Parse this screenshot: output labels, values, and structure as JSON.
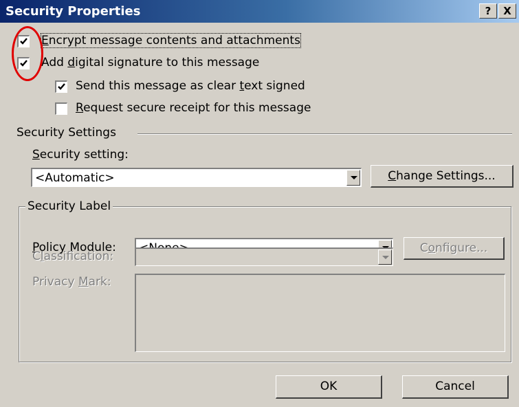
{
  "window": {
    "title": "Security Properties",
    "help_button": "?",
    "close_button": "X"
  },
  "options": {
    "encrypt": {
      "label": "Encrypt message contents and attachments",
      "checked": true
    },
    "signature": {
      "label": "Add digital signature to this message",
      "checked": true
    },
    "clear_text": {
      "label": "Send this message as clear text signed",
      "checked": true
    },
    "receipt": {
      "label": "Request secure receipt for this message",
      "checked": false
    }
  },
  "security_settings": {
    "group_title": "Security Settings",
    "setting_label": "Security setting:",
    "setting_value": "<Automatic>",
    "change_button": "Change Settings..."
  },
  "security_label": {
    "group_title": "Security Label",
    "policy_label": "Policy Module:",
    "policy_value": "<None>",
    "configure_button": "Configure...",
    "classification_label": "Classification:",
    "classification_value": "",
    "privacy_label": "Privacy Mark:",
    "privacy_value": ""
  },
  "footer": {
    "ok_button": "OK",
    "cancel_button": "Cancel"
  },
  "annotation": {
    "color": "#e00000"
  }
}
